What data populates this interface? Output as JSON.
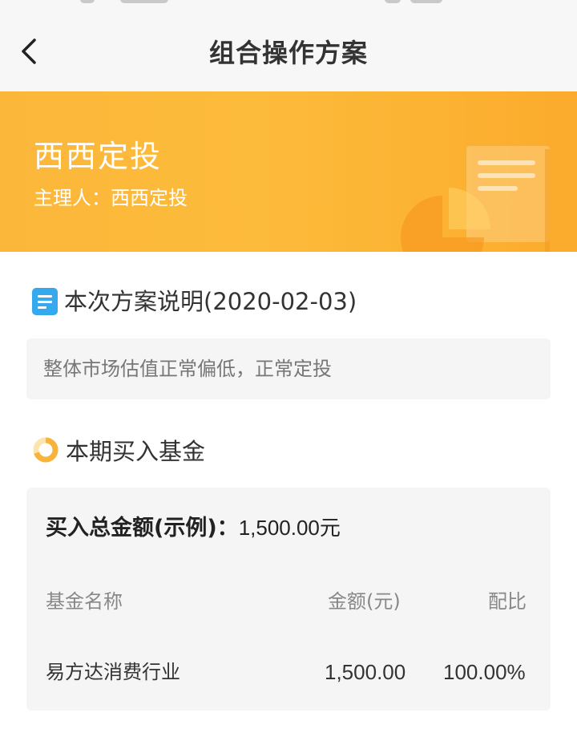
{
  "nav": {
    "title": "组合操作方案",
    "back_icon": "chevron-left-icon"
  },
  "banner": {
    "title": "西西定投",
    "manager": "主理人：西西定投",
    "gradient_colors": [
      "#fbb73a",
      "#fbab2c"
    ]
  },
  "plan_section": {
    "icon": "document-icon",
    "icon_color": "#35a9ee",
    "heading": "本次方案说明(2020-02-03)",
    "description": "整体市场估值正常偏低，正常定投"
  },
  "buy_section": {
    "icon": "donut-chart-icon",
    "heading": "本期买入基金",
    "total_label": "买入总金额(示例)：",
    "total_value": "1,500.00元",
    "columns": {
      "name": "基金名称",
      "amount": "金额(元)",
      "ratio": "配比"
    },
    "rows": [
      {
        "name": "易方达消费行业",
        "amount": "1,500.00",
        "ratio": "100.00%"
      }
    ]
  }
}
